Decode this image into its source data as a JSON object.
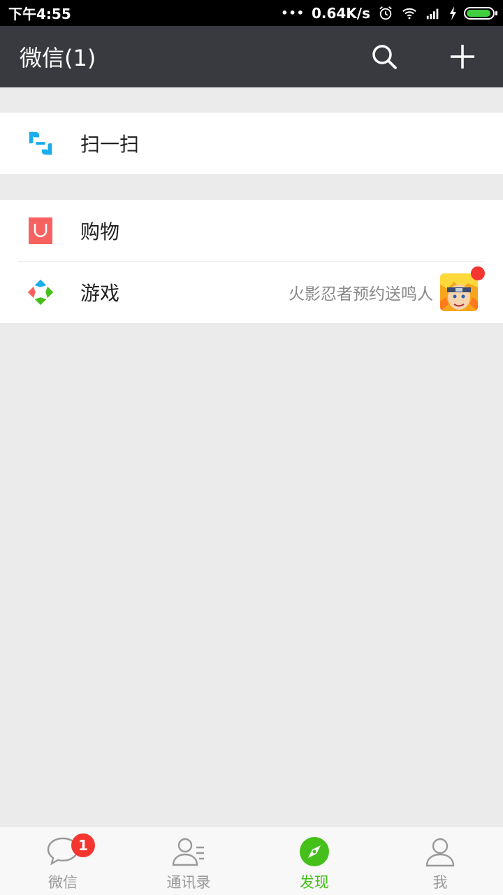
{
  "status_bar": {
    "time": "下午4:55",
    "net_speed": "0.64K/s"
  },
  "app_bar": {
    "title": "微信(1)",
    "search_icon": "search-icon",
    "add_icon": "plus-icon"
  },
  "groups": [
    {
      "items": [
        {
          "label": "扫一扫",
          "icon": "scan-icon"
        }
      ]
    },
    {
      "items": [
        {
          "label": "购物",
          "icon": "shopping-bag-icon"
        },
        {
          "label": "游戏",
          "icon": "game-icon",
          "subtitle": "火影忍者预约送鸣人"
        }
      ]
    }
  ],
  "tabs": [
    {
      "label": "微信",
      "icon": "chat-icon",
      "badge": "1"
    },
    {
      "label": "通讯录",
      "icon": "contacts-icon"
    },
    {
      "label": "发现",
      "icon": "discover-compass-icon",
      "active": true
    },
    {
      "label": "我",
      "icon": "me-person-icon"
    }
  ],
  "colors": {
    "app_bar": "#393a3f",
    "accent_green": "#45c01a",
    "badge_red": "#f43530",
    "scan_blue": "#1aadee",
    "shopping_red": "#f76260"
  }
}
